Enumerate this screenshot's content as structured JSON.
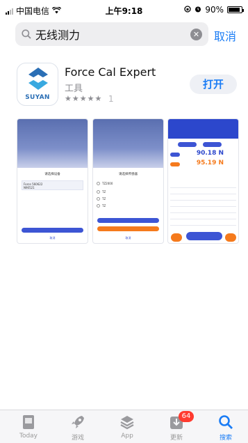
{
  "status_bar": {
    "carrier": "中国电信",
    "time": "上午9:18",
    "battery": "90%",
    "battery_level": 0.9
  },
  "search": {
    "query": "无线测力",
    "cancel_label": "取消"
  },
  "app": {
    "name": "Force Cal Expert",
    "category": "工具",
    "stars": "★★★★★",
    "rating_count": "1",
    "open_label": "打开",
    "icon_brand": "SUYAN"
  },
  "tabbar": {
    "items": [
      {
        "label": "Today"
      },
      {
        "label": "游戏"
      },
      {
        "label": "App"
      },
      {
        "label": "更新"
      },
      {
        "label": "搜索"
      }
    ],
    "update_badge": "64"
  },
  "colors": {
    "accent": "#1a7cf5",
    "badge": "#ff3b30"
  }
}
